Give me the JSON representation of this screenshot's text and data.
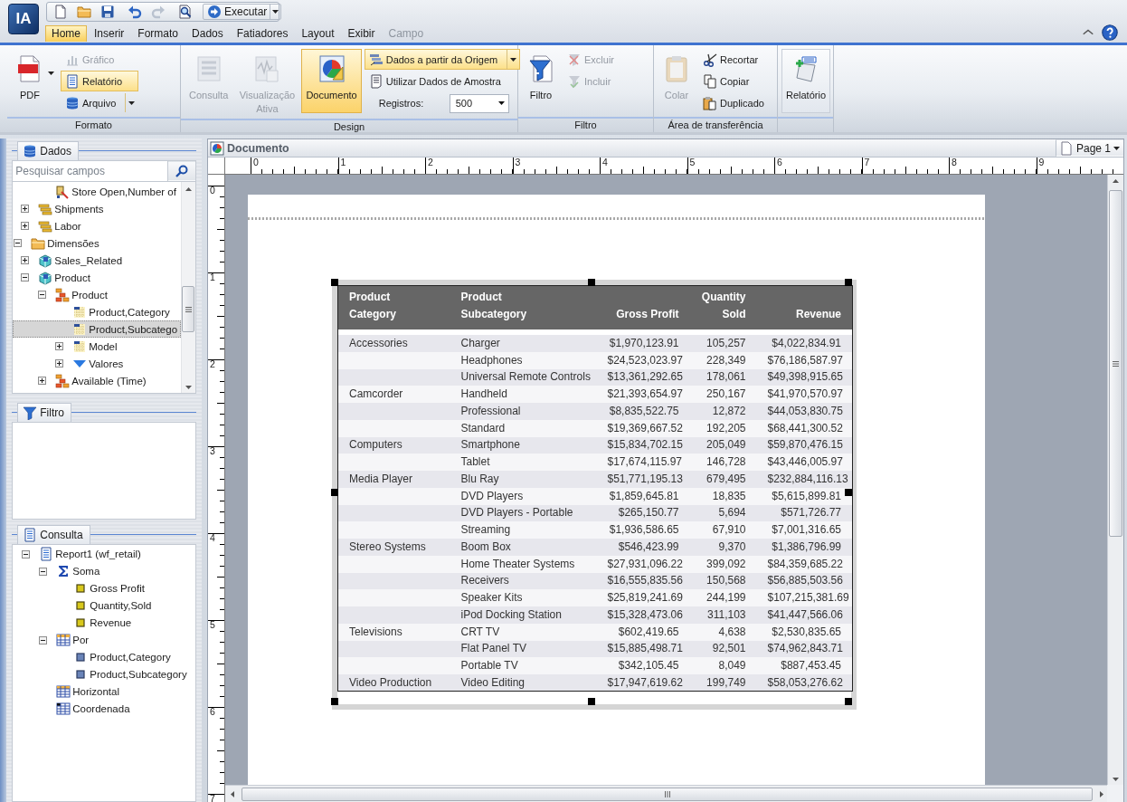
{
  "app": {
    "logo": "IA"
  },
  "quick_access": {
    "run_button": {
      "label": "Executar",
      "dropdown": true
    }
  },
  "menu_tabs": [
    {
      "label": "Home",
      "selected": true,
      "disabled": false
    },
    {
      "label": "Inserir",
      "selected": false,
      "disabled": false
    },
    {
      "label": "Formato",
      "selected": false,
      "disabled": false
    },
    {
      "label": "Dados",
      "selected": false,
      "disabled": false
    },
    {
      "label": "Fatiadores",
      "selected": false,
      "disabled": false
    },
    {
      "label": "Layout",
      "selected": false,
      "disabled": false
    },
    {
      "label": "Exibir",
      "selected": false,
      "disabled": false
    },
    {
      "label": "Campo",
      "selected": false,
      "disabled": true
    }
  ],
  "ribbon": {
    "groups": [
      {
        "title": "Formato",
        "items": [
          {
            "kind": "large",
            "label": "PDF",
            "selected": false,
            "disabled": false,
            "dropdown": true
          },
          {
            "kind": "stack",
            "items": [
              {
                "kind": "button",
                "label": "Gráfico",
                "selected": false,
                "disabled": true,
                "dropdown": false
              },
              {
                "kind": "button",
                "label": "Relatório",
                "selected": true,
                "disabled": false,
                "dropdown": false
              },
              {
                "kind": "button",
                "label": "Arquivo",
                "selected": false,
                "disabled": false,
                "dropdown": true
              }
            ]
          }
        ]
      },
      {
        "title": "Design",
        "items": [
          {
            "kind": "large",
            "label": "Consulta",
            "selected": false,
            "disabled": true,
            "dropdown": false
          },
          {
            "kind": "large",
            "label": "Visualização Ativa",
            "selected": false,
            "disabled": true,
            "dropdown": false
          },
          {
            "kind": "large",
            "label": "Documento",
            "selected": true,
            "disabled": false,
            "dropdown": false
          },
          {
            "kind": "stack",
            "items": [
              {
                "kind": "button",
                "label": "Dados a partir da Origem",
                "selected": true,
                "disabled": false,
                "dropdown": true
              },
              {
                "kind": "button",
                "label": "Utilizar Dados de Amostra",
                "selected": false,
                "disabled": false,
                "dropdown": false
              },
              {
                "kind": "field",
                "label": "Registros:",
                "value": "500"
              }
            ]
          }
        ]
      },
      {
        "title": "Filtro",
        "items": [
          {
            "kind": "large",
            "label": "Filtro",
            "selected": false,
            "disabled": false,
            "dropdown": false
          },
          {
            "kind": "stack",
            "items": [
              {
                "kind": "button",
                "label": "Excluir",
                "selected": false,
                "disabled": true,
                "dropdown": false
              },
              {
                "kind": "button",
                "label": "Incluir",
                "selected": false,
                "disabled": true,
                "dropdown": false
              }
            ]
          }
        ]
      },
      {
        "title": "Área de transferência",
        "items": [
          {
            "kind": "large",
            "label": "Colar",
            "selected": false,
            "disabled": true,
            "dropdown": false
          },
          {
            "kind": "stack",
            "items": [
              {
                "kind": "button",
                "label": "Recortar",
                "selected": false,
                "disabled": false,
                "dropdown": false
              },
              {
                "kind": "button",
                "label": "Copiar",
                "selected": false,
                "disabled": false,
                "dropdown": false
              },
              {
                "kind": "button",
                "label": "Duplicado",
                "selected": false,
                "disabled": false,
                "dropdown": false
              }
            ]
          }
        ]
      },
      {
        "items": [
          {
            "kind": "large",
            "label": "Relatório",
            "disabled": false,
            "dropdown": false
          }
        ]
      }
    ]
  },
  "data_panel": {
    "title": "Dados",
    "search": {
      "placeholder": "Pesquisar campos"
    },
    "tree": [
      {
        "kind": "offscreen",
        "children": [
          {
            "kind": "offscreen",
            "children": [
              {
                "kind": "measure",
                "label": "Store Open,Number of",
                "selected": false
              }
            ]
          },
          {
            "kind": "measure-group",
            "label": "Shipments",
            "expanded": false,
            "selected": false
          },
          {
            "kind": "measure-group",
            "label": "Labor",
            "expanded": false,
            "selected": false
          }
        ]
      },
      {
        "kind": "folder",
        "label": "Dimensões",
        "expanded": true,
        "selected": false,
        "children": [
          {
            "kind": "dimension",
            "label": "Sales_Related",
            "expanded": false,
            "selected": false
          },
          {
            "kind": "dimension",
            "label": "Product",
            "expanded": true,
            "selected": false,
            "children": [
              {
                "kind": "hierarchy",
                "label": "Product",
                "expanded": true,
                "selected": false,
                "children": [
                  {
                    "kind": "level",
                    "label": "Product,Category",
                    "selected": false
                  },
                  {
                    "kind": "level",
                    "label": "Product,Subcatego",
                    "selected": true
                  },
                  {
                    "kind": "level",
                    "label": "Model",
                    "expanded": false,
                    "selected": false
                  },
                  {
                    "kind": "values",
                    "label": "Valores",
                    "expanded": false,
                    "selected": false
                  }
                ]
              },
              {
                "kind": "hierarchy",
                "label": "Available (Time)",
                "expanded": false,
                "selected": false
              }
            ]
          }
        ]
      }
    ]
  },
  "filter_panel": {
    "title": "Filtro"
  },
  "query_panel": {
    "title": "Consulta",
    "tree": [
      {
        "kind": "report",
        "label": "Report1 (wf_retail)",
        "expanded": true,
        "selected": false,
        "children": [
          {
            "kind": "sum",
            "label": "Soma",
            "expanded": true,
            "selected": false,
            "children": [
              {
                "kind": "measure-field",
                "label": "Gross Profit",
                "selected": false
              },
              {
                "kind": "measure-field",
                "label": "Quantity,Sold",
                "selected": false
              },
              {
                "kind": "measure-field",
                "label": "Revenue",
                "selected": false
              }
            ]
          },
          {
            "kind": "by",
            "label": "Por",
            "expanded": true,
            "selected": false,
            "children": [
              {
                "kind": "dimension-field",
                "label": "Product,Category",
                "selected": false
              },
              {
                "kind": "dimension-field",
                "label": "Product,Subcategory",
                "selected": false
              }
            ]
          },
          {
            "kind": "across",
            "label": "Horizontal",
            "selected": false
          },
          {
            "kind": "coordinate",
            "label": "Coordenada",
            "selected": false
          }
        ]
      }
    ]
  },
  "document": {
    "title": "Documento",
    "page_button": "Page 1",
    "ruler": {
      "horizontal": [
        "0",
        "1",
        "2",
        "3",
        "4",
        "5",
        "6",
        "7",
        "8",
        "9"
      ],
      "vertical": [
        "0",
        "1",
        "2",
        "3",
        "4",
        "5",
        "6",
        "7"
      ]
    },
    "table": {
      "columns": [
        {
          "lines": [
            "Product",
            "Category"
          ]
        },
        {
          "lines": [
            "Product",
            "Subcategory"
          ]
        },
        {
          "lines": [
            "Gross Profit"
          ]
        },
        {
          "lines": [
            "Quantity",
            "Sold"
          ]
        },
        {
          "lines": [
            "Revenue"
          ]
        }
      ],
      "rows": [
        {
          "category": "Accessories",
          "subcategory": "Charger",
          "gross_profit": "$1,970,123.91",
          "quantity_sold": "105,257",
          "revenue": "$4,022,834.91"
        },
        {
          "subcategory": "Headphones",
          "gross_profit": "$24,523,023.97",
          "quantity_sold": "228,349",
          "revenue": "$76,186,587.97"
        },
        {
          "subcategory": "Universal Remote Controls",
          "gross_profit": "$13,361,292.65",
          "quantity_sold": "178,061",
          "revenue": "$49,398,915.65"
        },
        {
          "category": "Camcorder",
          "subcategory": "Handheld",
          "gross_profit": "$21,393,654.97",
          "quantity_sold": "250,167",
          "revenue": "$41,970,570.97"
        },
        {
          "subcategory": "Professional",
          "gross_profit": "$8,835,522.75",
          "quantity_sold": "12,872",
          "revenue": "$44,053,830.75"
        },
        {
          "subcategory": "Standard",
          "gross_profit": "$19,369,667.52",
          "quantity_sold": "192,205",
          "revenue": "$68,441,300.52"
        },
        {
          "category": "Computers",
          "subcategory": "Smartphone",
          "gross_profit": "$15,834,702.15",
          "quantity_sold": "205,049",
          "revenue": "$59,870,476.15"
        },
        {
          "subcategory": "Tablet",
          "gross_profit": "$17,674,115.97",
          "quantity_sold": "146,728",
          "revenue": "$43,446,005.97"
        },
        {
          "category": "Media Player",
          "subcategory": "Blu Ray",
          "gross_profit": "$51,771,195.13",
          "quantity_sold": "679,495",
          "revenue": "$232,884,116.13"
        },
        {
          "subcategory": "DVD Players",
          "gross_profit": "$1,859,645.81",
          "quantity_sold": "18,835",
          "revenue": "$5,615,899.81"
        },
        {
          "subcategory": "DVD Players - Portable",
          "gross_profit": "$265,150.77",
          "quantity_sold": "5,694",
          "revenue": "$571,726.77"
        },
        {
          "subcategory": "Streaming",
          "gross_profit": "$1,936,586.65",
          "quantity_sold": "67,910",
          "revenue": "$7,001,316.65"
        },
        {
          "category": "Stereo Systems",
          "subcategory": "Boom Box",
          "gross_profit": "$546,423.99",
          "quantity_sold": "9,370",
          "revenue": "$1,386,796.99"
        },
        {
          "subcategory": "Home Theater Systems",
          "gross_profit": "$27,931,096.22",
          "quantity_sold": "399,092",
          "revenue": "$84,359,685.22"
        },
        {
          "subcategory": "Receivers",
          "gross_profit": "$16,555,835.56",
          "quantity_sold": "150,568",
          "revenue": "$56,885,503.56"
        },
        {
          "subcategory": "Speaker Kits",
          "gross_profit": "$25,819,241.69",
          "quantity_sold": "244,199",
          "revenue": "$107,215,381.69"
        },
        {
          "subcategory": "iPod Docking Station",
          "gross_profit": "$15,328,473.06",
          "quantity_sold": "311,103",
          "revenue": "$41,447,566.06"
        },
        {
          "category": "Televisions",
          "subcategory": "CRT TV",
          "gross_profit": "$602,419.65",
          "quantity_sold": "4,638",
          "revenue": "$2,530,835.65"
        },
        {
          "subcategory": "Flat Panel TV",
          "gross_profit": "$15,885,498.71",
          "quantity_sold": "92,501",
          "revenue": "$74,962,843.71"
        },
        {
          "subcategory": "Portable TV",
          "gross_profit": "$342,105.45",
          "quantity_sold": "8,049",
          "revenue": "$887,453.45"
        },
        {
          "category": "Video Production",
          "subcategory": "Video Editing",
          "gross_profit": "$17,947,619.62",
          "quantity_sold": "199,749",
          "revenue": "$58,053,276.62"
        }
      ]
    }
  }
}
